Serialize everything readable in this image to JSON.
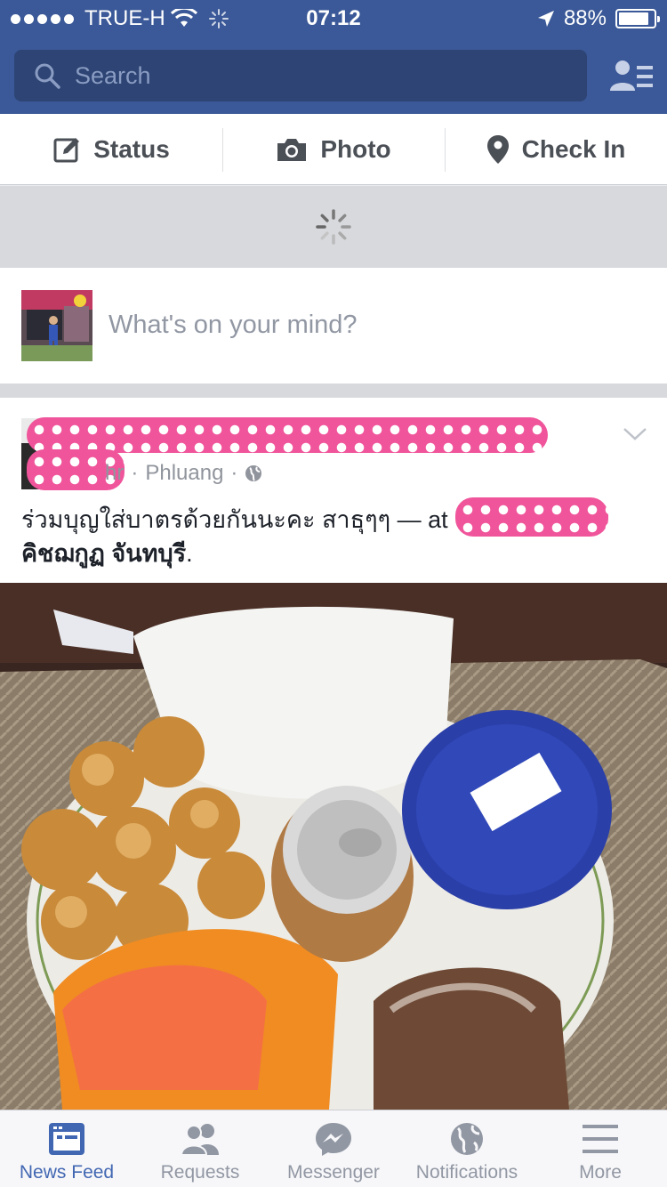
{
  "status_bar": {
    "carrier": "TRUE-H",
    "time": "07:12",
    "battery_percent": "88%",
    "battery_level": 0.88
  },
  "header": {
    "search_placeholder": "Search",
    "friends_icon": "friends-list-icon"
  },
  "composer_actions": [
    {
      "label": "Status",
      "icon": "edit-icon"
    },
    {
      "label": "Photo",
      "icon": "camera-icon"
    },
    {
      "label": "Check In",
      "icon": "location-pin-icon"
    }
  ],
  "composer": {
    "prompt": "What's on your mind?"
  },
  "post": {
    "meta_partial": "hr",
    "location": "Phluang",
    "separator": "·",
    "text_main": "ร่วมบุญใส่บาตรด้วยกันนะคะ สาธุๆๆ — at ",
    "place_fragment": "คิชฌกูฏ จันทบุรี",
    "place_suffix": "."
  },
  "tabs": [
    {
      "label": "News Feed",
      "icon": "news-feed-icon",
      "active": true
    },
    {
      "label": "Requests",
      "icon": "friend-requests-icon",
      "active": false
    },
    {
      "label": "Messenger",
      "icon": "messenger-icon",
      "active": false
    },
    {
      "label": "Notifications",
      "icon": "globe-icon",
      "active": false
    },
    {
      "label": "More",
      "icon": "menu-icon",
      "active": false
    }
  ],
  "colors": {
    "brand": "#3b5998",
    "active_tab": "#4267b2",
    "redaction": "#f0559b"
  }
}
